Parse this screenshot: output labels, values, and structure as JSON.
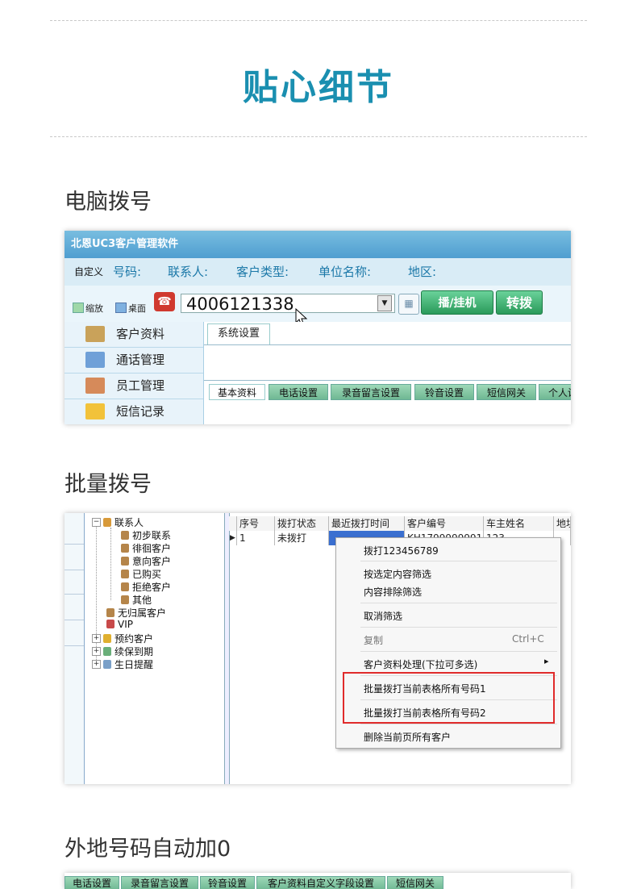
{
  "page": {
    "title": "贴心细节",
    "sections": [
      "电脑拨号",
      "批量拨号",
      "外地号码自动加0"
    ]
  },
  "shot1": {
    "app_title": "北恩UC3客户管理软件",
    "search": {
      "custom_label": "自定义",
      "fields": [
        "号码:",
        "联系人:",
        "客户类型:",
        "单位名称:",
        "地区:"
      ]
    },
    "dial": {
      "opt_zoom": "缩放",
      "opt_desktop": "桌面",
      "number": "4006121338",
      "btn_dial": "播/挂机",
      "btn_transfer": "转拨"
    },
    "nav": [
      {
        "label": "客户资料",
        "icon": "customer-icon",
        "color": "#c9a25a"
      },
      {
        "label": "通话管理",
        "icon": "call-icon",
        "color": "#6fa0d8"
      },
      {
        "label": "员工管理",
        "icon": "staff-icon",
        "color": "#d68a5a"
      },
      {
        "label": "短信记录",
        "icon": "envelope-icon",
        "color": "#f2c23a"
      }
    ],
    "sys_tab": "系统设置",
    "sub_tabs": [
      "基本资料",
      "电话设置",
      "录音留言设置",
      "铃音设置",
      "短信网关",
      "个人设"
    ]
  },
  "shot2": {
    "tree": {
      "root": "联系人",
      "children": [
        "初步联系",
        "徘徊客户",
        "意向客户",
        "已购买",
        "拒绝客户",
        "其他"
      ],
      "others": [
        "无归属客户",
        "VIP",
        "预约客户",
        "续保到期",
        "生日提醒"
      ]
    },
    "grid": {
      "headers": [
        "序号",
        "拨打状态",
        "最近拨打时间",
        "客户编号",
        "车主姓名",
        "地址"
      ],
      "row": [
        "1",
        "未拨打",
        "",
        "KH1799999991",
        "123",
        ""
      ]
    },
    "menu": {
      "items": [
        "拨打123456789",
        "按选定内容筛选",
        "内容排除筛选",
        "取消筛选",
        "复制",
        "客户资料处理(下拉可多选)",
        "批量拨打当前表格所有号码1",
        "批量拨打当前表格所有号码2",
        "删除当前页所有客户"
      ],
      "copy_shortcut": "Ctrl+C",
      "submenu_arrow": "▸"
    },
    "highlight_color": "#e02b2b"
  },
  "shot3": {
    "tabs": [
      "电话设置",
      "录音留言设置",
      "铃音设置",
      "客户资料自定义字段设置",
      "短信网关"
    ]
  }
}
